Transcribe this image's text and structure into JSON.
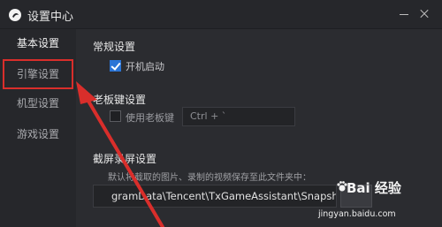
{
  "window": {
    "title": "设置中心"
  },
  "sidebar": {
    "items": [
      {
        "label": "基本设置"
      },
      {
        "label": "引擎设置"
      },
      {
        "label": "机型设置"
      },
      {
        "label": "游戏设置"
      }
    ]
  },
  "sections": {
    "general": {
      "title": "常规设置",
      "autostart_label": "开机启动",
      "autostart_checked": true
    },
    "bosskey": {
      "title": "老板键设置",
      "enable_label": "使用老板键",
      "enable_checked": false,
      "hotkey_value": "Ctrl + `"
    },
    "screenshot": {
      "title": "截屏录屏设置",
      "note": "默认将截取的图片、录制的视频保存至此文件夹中：",
      "path_value": "gramData\\Tencent\\TxGameAssistant\\Snapshot"
    }
  },
  "watermark": {
    "logo_text": "Bai 经验",
    "url": "jingyan.baidu.com"
  },
  "colors": {
    "background": "#2b2c30",
    "sidebar": "#26272b",
    "highlight_box": "#d92e2b",
    "arrow": "#d92e2b",
    "checkbox_accent": "#2b75d6"
  },
  "icons": {
    "app": "tencent-assistant-icon",
    "minimize": "minimize-icon",
    "close": "close-icon",
    "checkmark": "checkmark-icon",
    "arrow": "red-arrow-annotation"
  }
}
